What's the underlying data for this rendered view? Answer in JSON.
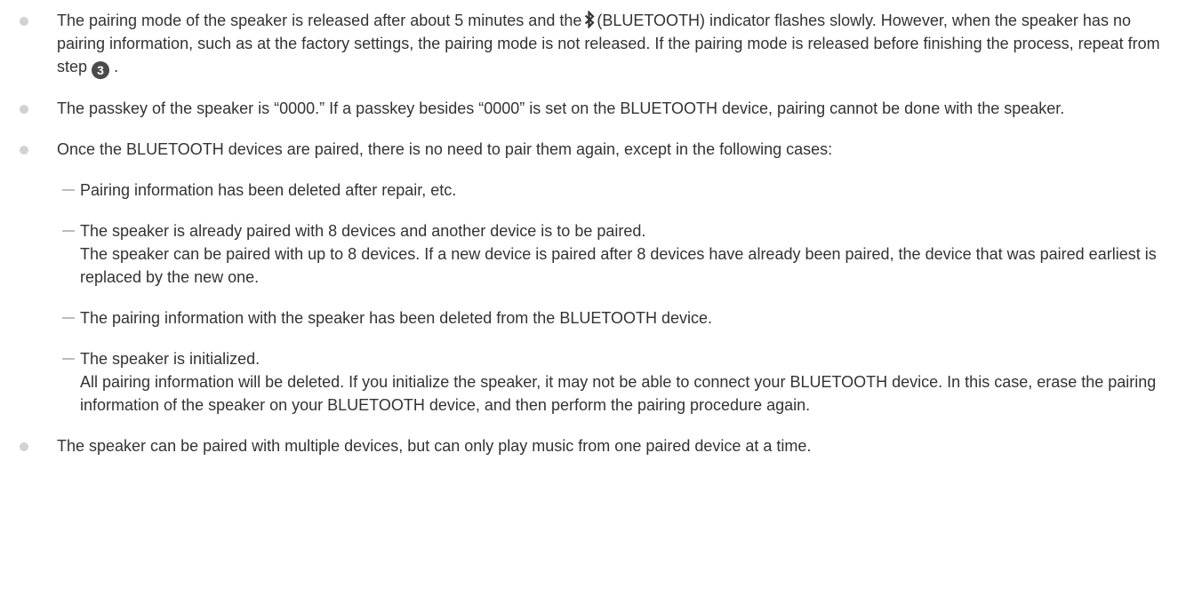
{
  "notes": [
    {
      "part1": "The pairing mode of the speaker is released after about 5 minutes and the",
      "bluetooth_icon": "bluetooth-icon",
      "part2": "(BLUETOOTH) indicator flashes slowly. However, when the speaker has no pairing information, such as at the factory settings, the pairing mode is not released. If the pairing mode is released before finishing the process, repeat from step",
      "step_number": "3",
      "part3": "."
    },
    {
      "text": "The passkey of the speaker is “0000.” If a passkey besides “0000” is set on the BLUETOOTH device, pairing cannot be done with the speaker."
    },
    {
      "text": "Once the BLUETOOTH devices are paired, there is no need to pair them again, except in the following cases:",
      "cases": [
        {
          "title": "Pairing information has been deleted after repair, etc."
        },
        {
          "title": "The speaker is already paired with 8 devices and another device is to be paired.",
          "detail": "The speaker can be paired with up to 8 devices. If a new device is paired after 8 devices have already been paired, the device that was paired earliest is replaced by the new one."
        },
        {
          "title": "The pairing information with the speaker has been deleted from the BLUETOOTH device."
        },
        {
          "title": "The speaker is initialized.",
          "detail": "All pairing information will be deleted. If you initialize the speaker, it may not be able to connect your BLUETOOTH device. In this case, erase the pairing information of the speaker on your BLUETOOTH device, and then perform the pairing procedure again."
        }
      ]
    },
    {
      "text": "The speaker can be paired with multiple devices, but can only play music from one paired device at a time."
    }
  ],
  "colors": {
    "text": "#333333",
    "bullet": "#d2d2d2",
    "dash": "#bdbdbd",
    "step_badge": "#4a4a4a"
  }
}
